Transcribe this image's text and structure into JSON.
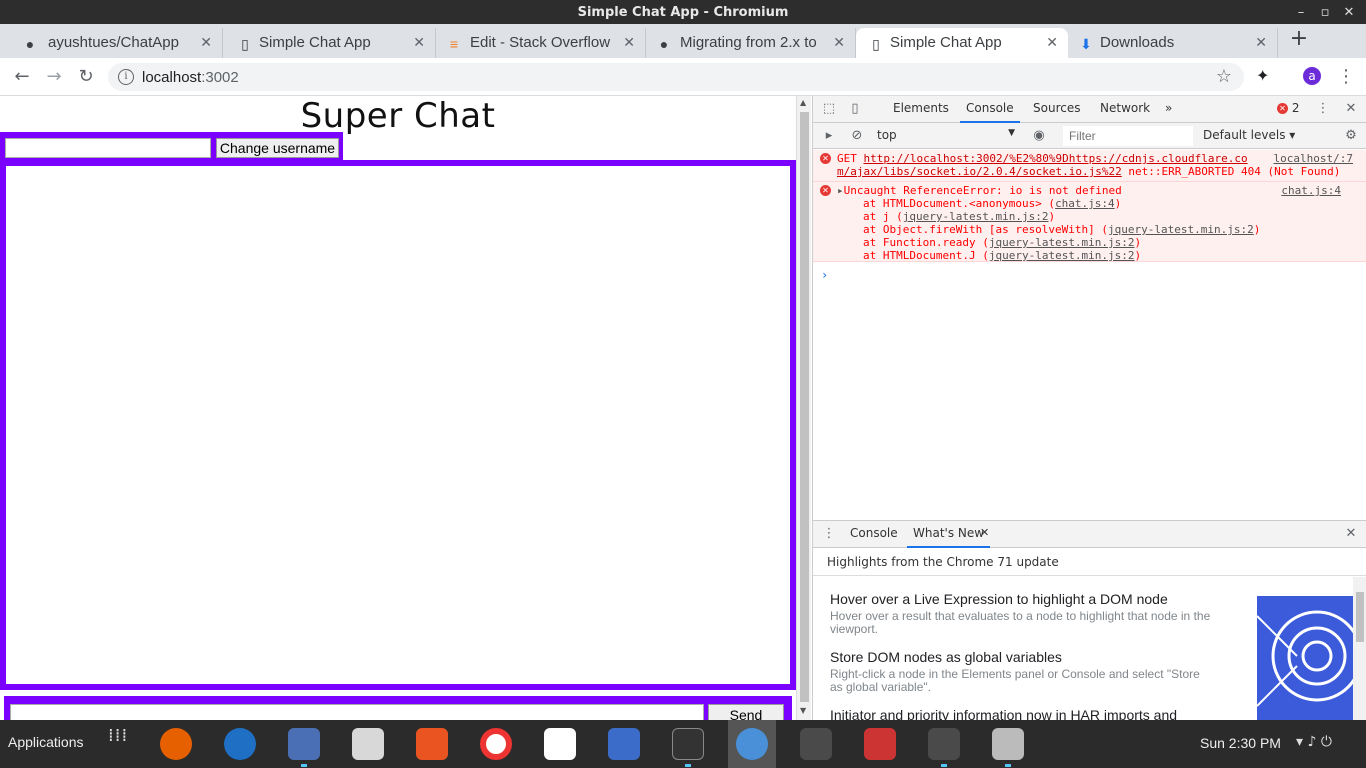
{
  "window": {
    "title": "Simple Chat App - Chromium"
  },
  "tabs": [
    {
      "label": "ayushtues/ChatApp",
      "icon": "github-icon"
    },
    {
      "label": "Simple Chat App",
      "icon": "page-icon"
    },
    {
      "label": "Edit - Stack Overflow",
      "icon": "stackoverflow-icon"
    },
    {
      "label": "Migrating from 2.x to",
      "icon": "github-icon"
    },
    {
      "label": "Simple Chat App",
      "icon": "page-icon",
      "active": true
    },
    {
      "label": "Downloads",
      "icon": "download-icon"
    }
  ],
  "toolbar": {
    "url_host": "localhost",
    "url_port": ":3002",
    "avatar_letter": "a"
  },
  "page": {
    "heading": "Super Chat",
    "change_username_label": "Change username",
    "send_label": "Send",
    "accent_color": "#7a00ff"
  },
  "devtools": {
    "tabs": [
      "Elements",
      "Console",
      "Sources",
      "Network"
    ],
    "error_count": "2",
    "context": "top",
    "filter_placeholder": "Filter",
    "levels": "Default levels",
    "errors": [
      {
        "line1_prefix": "GET ",
        "url": "http://localhost:3002/%E2%80%9Dhttps://cdnjs.cloudflare.co",
        "line2_url": "m/ajax/libs/socket.io/2.0.4/socket.io.js%22",
        "line2_suffix": " net::ERR_ABORTED 404 (Not Found)",
        "source": "localhost/:7"
      },
      {
        "title": "Uncaught ReferenceError: io is not defined",
        "source": "chat.js:4",
        "stack": [
          {
            "pre": "at HTMLDocument.<anonymous> (",
            "link": "chat.js:4",
            "post": ")"
          },
          {
            "pre": "at j (",
            "link": "jquery-latest.min.js:2",
            "post": ")"
          },
          {
            "pre": "at Object.fireWith [as resolveWith] (",
            "link": "jquery-latest.min.js:2",
            "post": ")"
          },
          {
            "pre": "at Function.ready (",
            "link": "jquery-latest.min.js:2",
            "post": ")"
          },
          {
            "pre": "at HTMLDocument.J (",
            "link": "jquery-latest.min.js:2",
            "post": ")"
          }
        ]
      }
    ],
    "drawer": {
      "tabs": [
        "Console",
        "What's New"
      ],
      "heading": "Highlights from the Chrome 71 update",
      "items": [
        {
          "title": "Hover over a Live Expression to highlight a DOM node",
          "desc": "Hover over a result that evaluates to a node to highlight that node in the viewport."
        },
        {
          "title": "Store DOM nodes as global variables",
          "desc": "Right-click a node in the Elements panel or Console and select \"Store as global variable\"."
        },
        {
          "title": "Initiator and priority information now in HAR imports and",
          "desc": ""
        }
      ]
    }
  },
  "taskbar": {
    "apps_label": "Applications",
    "clock": "Sun  2:30 PM"
  }
}
